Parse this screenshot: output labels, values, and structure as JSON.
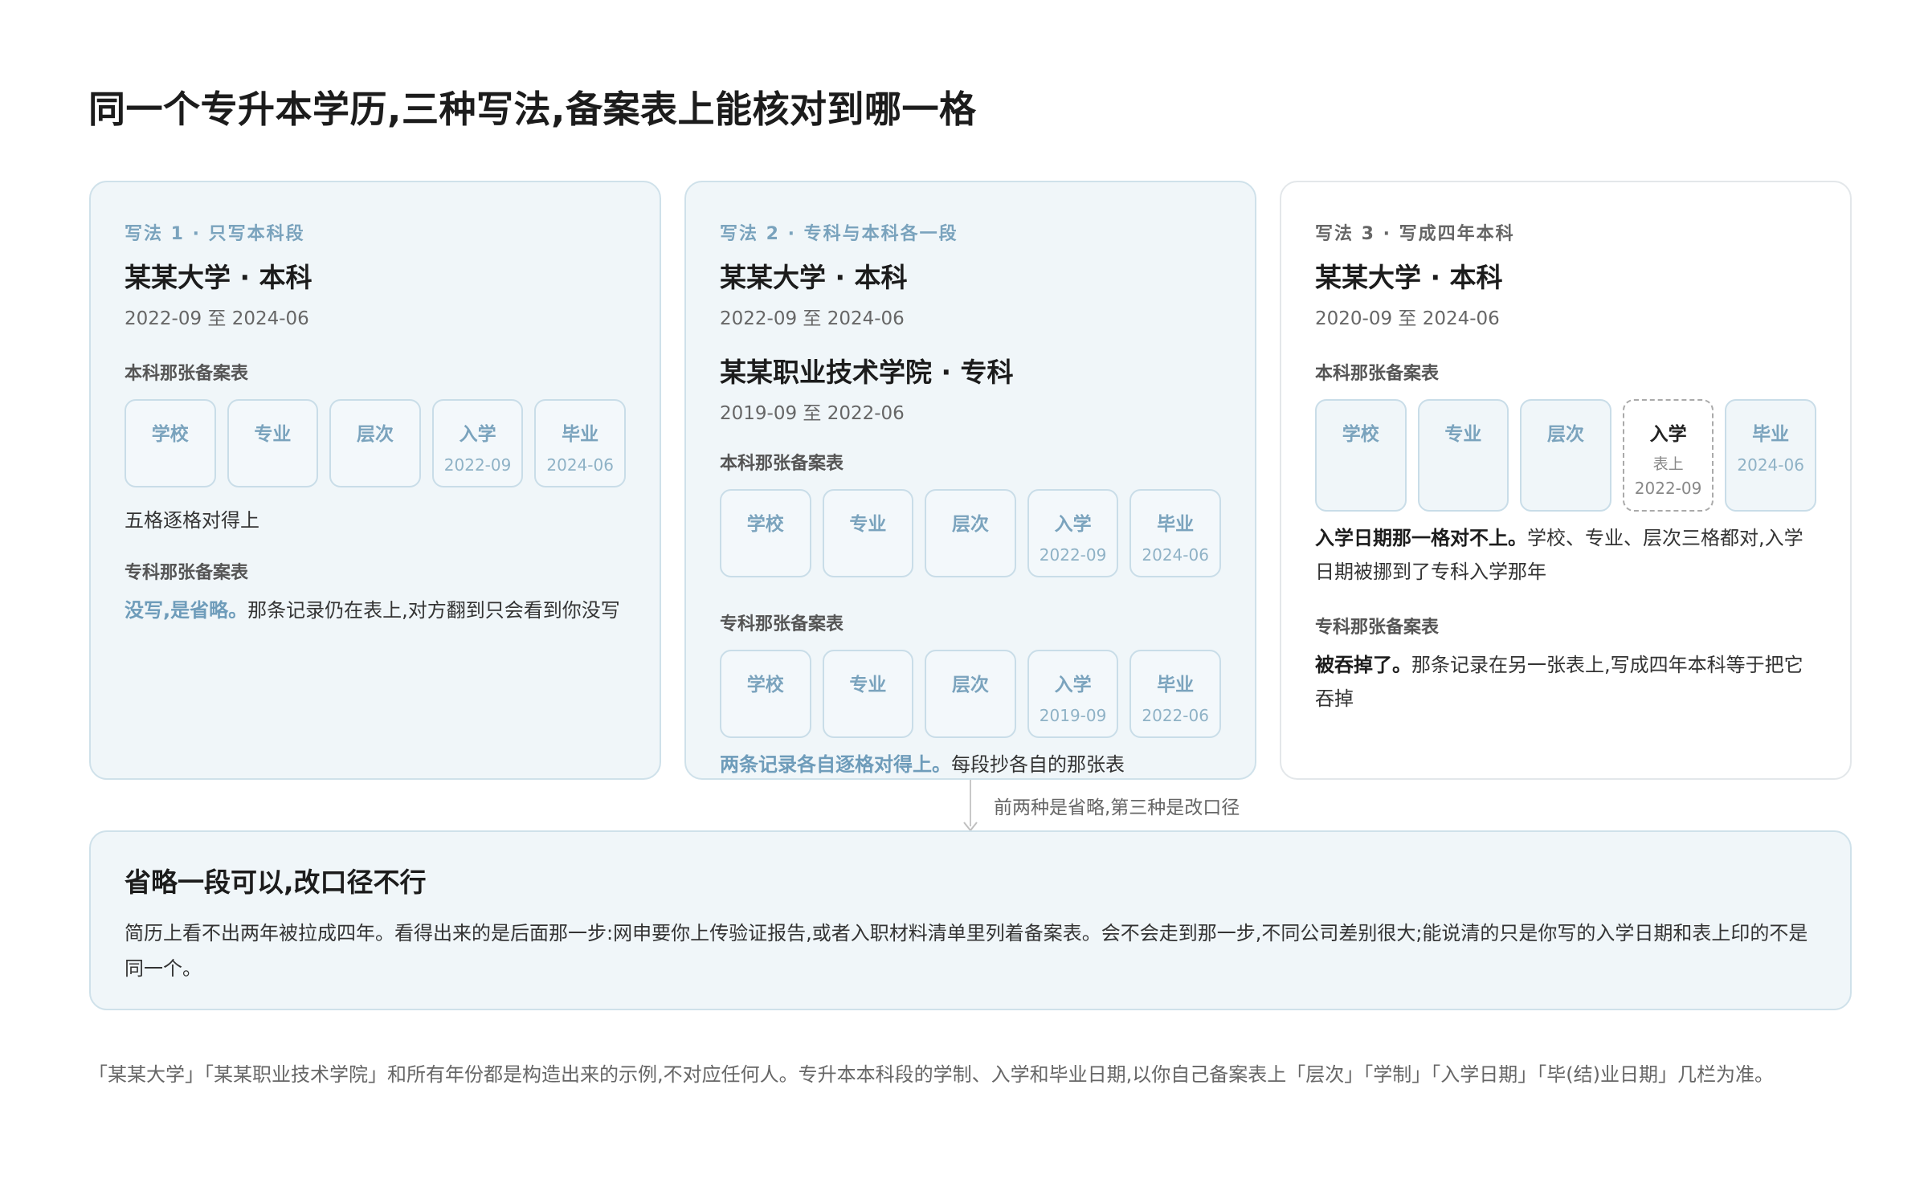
{
  "title": "同一个专升本学历,三种写法,备案表上能核对到哪一格",
  "cards": [
    {
      "kicker": "写法 1 · 只写本科段",
      "entries": [
        {
          "school": "某某大学 · 本科",
          "dates": "2022-09 至 2024-06"
        }
      ],
      "table1": {
        "label": "本科那张备案表",
        "cells": [
          {
            "name": "学校",
            "sub": ""
          },
          {
            "name": "专业",
            "sub": ""
          },
          {
            "name": "层次",
            "sub": ""
          },
          {
            "name": "入学",
            "sub": "2022-09"
          },
          {
            "name": "毕业",
            "sub": "2024-06"
          }
        ],
        "note": "五格逐格对得上"
      },
      "table2": {
        "label": "专科那张备案表",
        "note_em": "没写,是省略。",
        "note_rest": "那条记录仍在表上,对方翻到只会看到你没写"
      }
    },
    {
      "kicker": "写法 2 · 专科与本科各一段",
      "entries": [
        {
          "school": "某某大学 · 本科",
          "dates": "2022-09 至 2024-06"
        },
        {
          "school": "某某职业技术学院 · 专科",
          "dates": "2019-09 至 2022-06"
        }
      ],
      "table1": {
        "label": "本科那张备案表",
        "cells": [
          {
            "name": "学校",
            "sub": ""
          },
          {
            "name": "专业",
            "sub": ""
          },
          {
            "name": "层次",
            "sub": ""
          },
          {
            "name": "入学",
            "sub": "2022-09"
          },
          {
            "name": "毕业",
            "sub": "2024-06"
          }
        ]
      },
      "table2": {
        "label": "专科那张备案表",
        "cells": [
          {
            "name": "学校",
            "sub": ""
          },
          {
            "name": "专业",
            "sub": ""
          },
          {
            "name": "层次",
            "sub": ""
          },
          {
            "name": "入学",
            "sub": "2019-09"
          },
          {
            "name": "毕业",
            "sub": "2022-06"
          }
        ],
        "note_em": "两条记录各自逐格对得上。",
        "note_rest": "每段抄各自的那张表"
      }
    },
    {
      "kicker": "写法 3 · 写成四年本科",
      "entries": [
        {
          "school": "某某大学 · 本科",
          "dates": "2020-09 至 2024-06"
        }
      ],
      "table1": {
        "label": "本科那张备案表",
        "cells": [
          {
            "name": "学校",
            "sub": ""
          },
          {
            "name": "专业",
            "sub": ""
          },
          {
            "name": "层次",
            "sub": ""
          },
          {
            "name": "入学",
            "note": "表上",
            "sub": "2022-09",
            "mismatch": true
          },
          {
            "name": "毕业",
            "sub": "2024-06"
          }
        ],
        "note_em": "入学日期那一格对不上。",
        "note_rest": "学校、专业、层次三格都对,入学日期被挪到了专科入学那年"
      },
      "table2": {
        "label": "专科那张备案表",
        "note_em": "被吞掉了。",
        "note_rest": "那条记录在另一张表上,写成四年本科等于把它吞掉"
      }
    }
  ],
  "connector_label": "前两种是省略,第三种是改口径",
  "summary": {
    "title": "省略一段可以,改口径不行",
    "body": "简历上看不出两年被拉成四年。看得出来的是后面那一步:网申要你上传验证报告,或者入职材料清单里列着备案表。会不会走到那一步,不同公司差别很大;能说清的只是你写的入学日期和表上印的不是同一个。"
  },
  "footnote": "「某某大学」「某某职业技术学院」和所有年份都是构造出来的示例,不对应任何人。专升本本科段的学制、入学和毕业日期,以你自己备案表上「层次」「学制」「入学日期」「毕(结)业日期」几栏为准。"
}
